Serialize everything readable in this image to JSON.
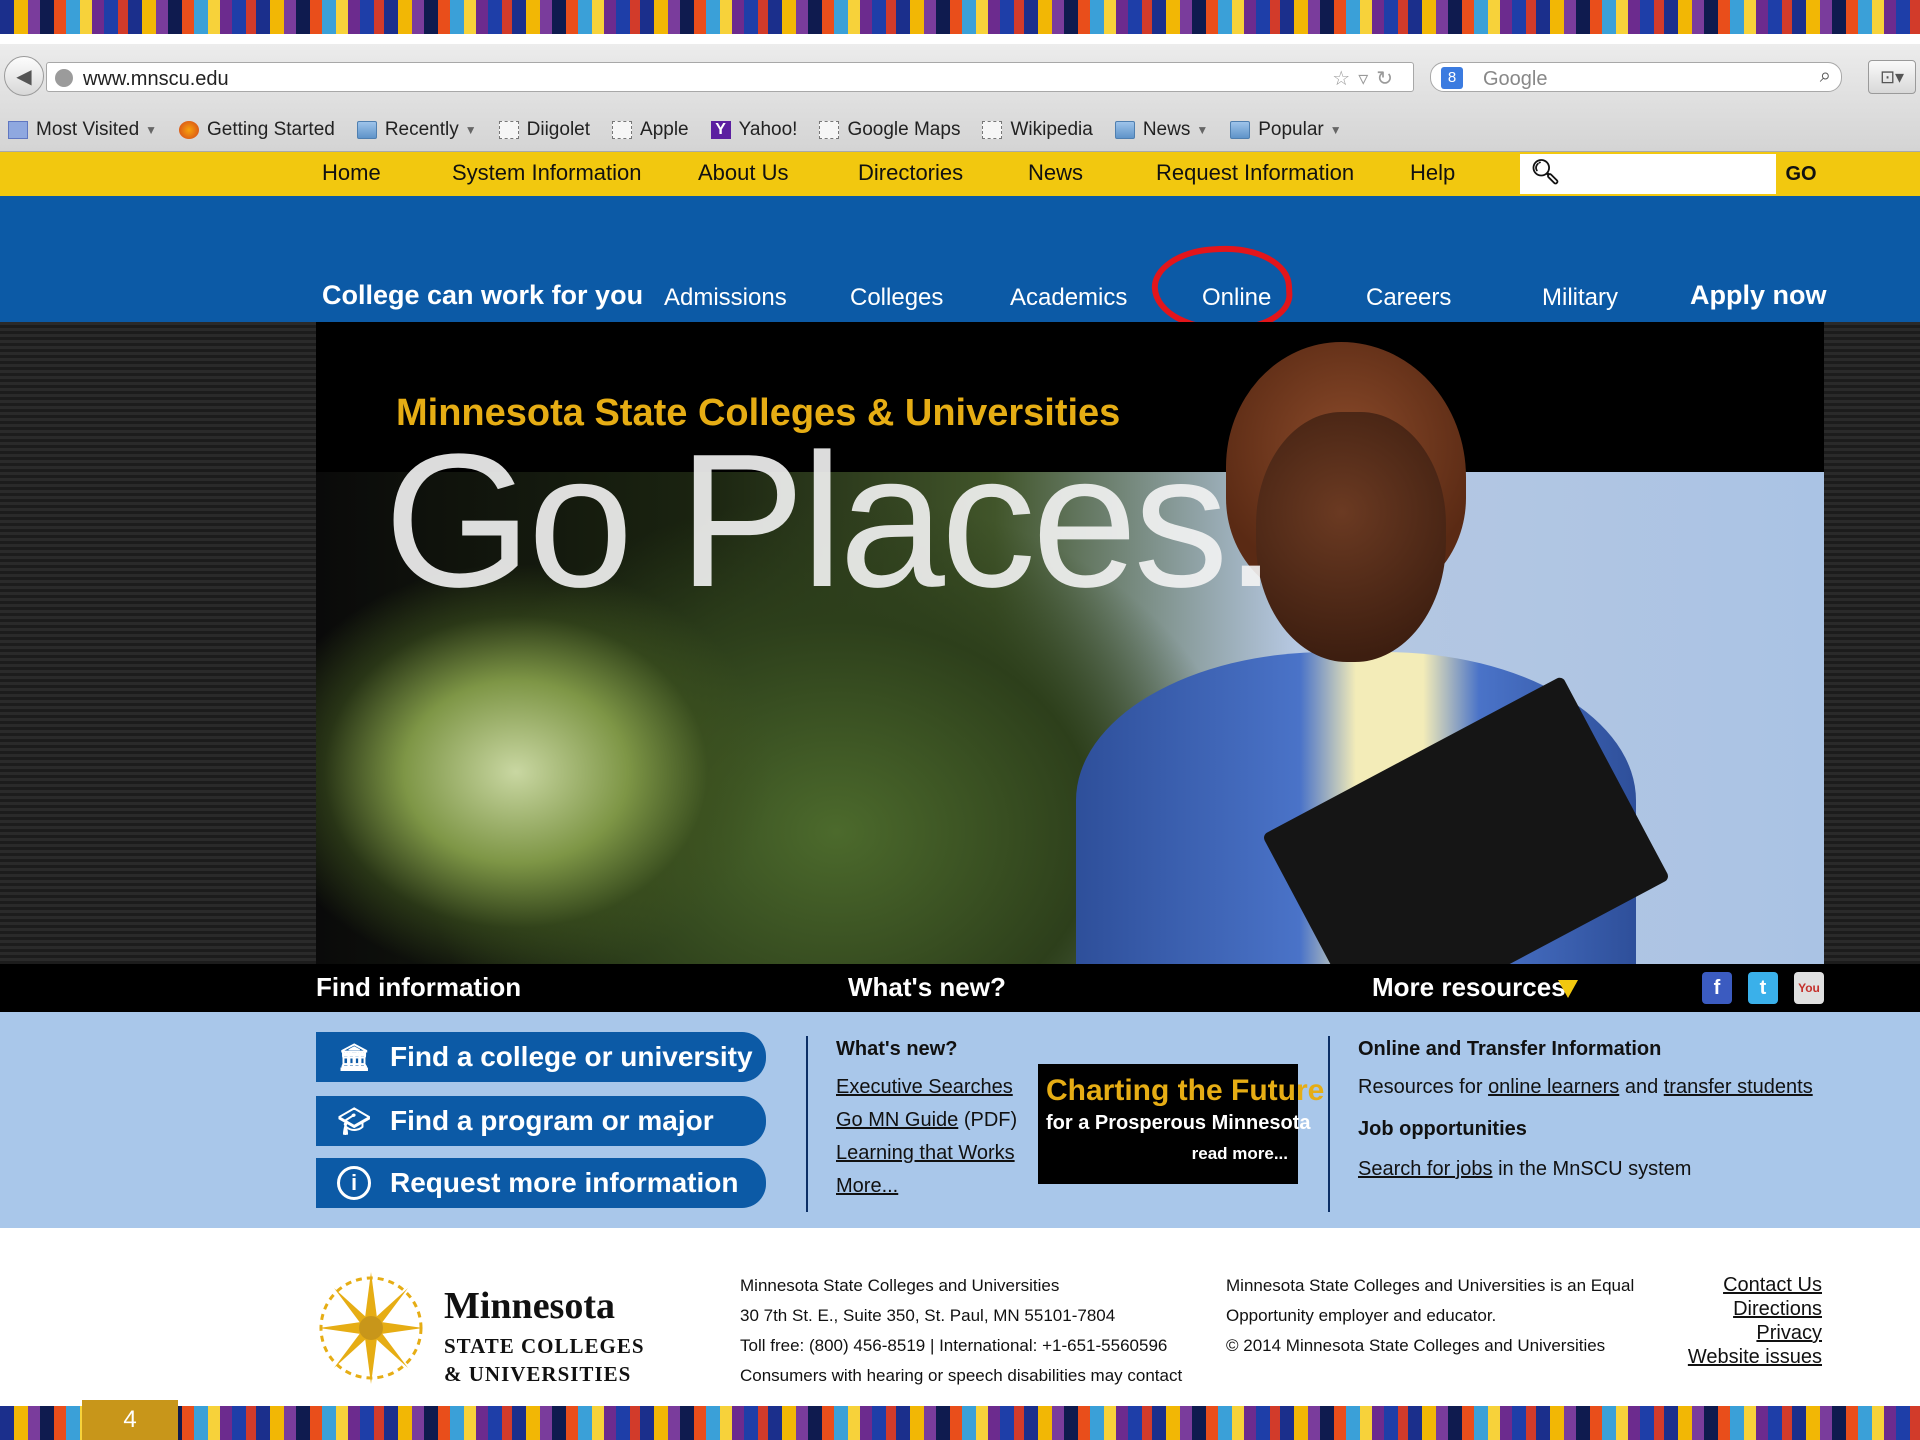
{
  "browser": {
    "url": "www.mnscu.edu",
    "search_placeholder": "Google",
    "search_badge": "8",
    "bookmarks": [
      {
        "label": "Most Visited",
        "dropdown": true,
        "icon": "most-visited-icon"
      },
      {
        "label": "Getting Started",
        "dropdown": false,
        "icon": "firefox-icon"
      },
      {
        "label": "Recently",
        "dropdown": true,
        "icon": "folder-icon"
      },
      {
        "label": "Diigolet",
        "dropdown": false,
        "icon": "page-icon"
      },
      {
        "label": "Apple",
        "dropdown": false,
        "icon": "page-icon"
      },
      {
        "label": "Yahoo!",
        "dropdown": false,
        "icon": "yahoo-icon"
      },
      {
        "label": "Google Maps",
        "dropdown": false,
        "icon": "page-icon"
      },
      {
        "label": "Wikipedia",
        "dropdown": false,
        "icon": "page-icon"
      },
      {
        "label": "News",
        "dropdown": true,
        "icon": "folder-icon"
      },
      {
        "label": "Popular",
        "dropdown": true,
        "icon": "folder-icon"
      }
    ]
  },
  "topnav": {
    "items": [
      "Home",
      "System Information",
      "About Us",
      "Directories",
      "News",
      "Request Information",
      "Help"
    ],
    "go_label": "GO"
  },
  "mainnav": {
    "tagline": "College can work for you",
    "items": [
      "Admissions",
      "Colleges",
      "Academics",
      "Online",
      "Careers",
      "Military"
    ],
    "apply": "Apply now"
  },
  "hero": {
    "subtitle": "Minnesota State Colleges & Universities",
    "title": "Go Places."
  },
  "infohead": {
    "find": "Find information",
    "whats_new": "What's new?",
    "more": "More resources",
    "social": {
      "facebook": "f",
      "twitter": "t",
      "youtube": "You Tube"
    }
  },
  "find_buttons": [
    "Find a college or university",
    "Find a program or major",
    "Request more information"
  ],
  "whats_new": {
    "heading": "What's new?",
    "links": [
      {
        "text": "Executive Searches",
        "suffix": ""
      },
      {
        "text": "Go MN Guide",
        "suffix": " (PDF)"
      },
      {
        "text": "Learning that Works",
        "suffix": ""
      },
      {
        "text": "More...",
        "suffix": ""
      }
    ],
    "promo": {
      "title": "Charting the Future",
      "subtitle": "for a Prosperous Minnesota",
      "more": "read more..."
    }
  },
  "resources": {
    "heading1": "Online and Transfer Information",
    "line1_pre": "Resources for ",
    "line1_link1": "online learners",
    "line1_mid": " and ",
    "line1_link2": "transfer students",
    "heading2": "Job opportunities",
    "line2_link": "Search for jobs",
    "line2_post": " in the MnSCU system"
  },
  "footer": {
    "logo_name": "Minnesota",
    "logo_line2": "STATE COLLEGES",
    "logo_line3": "& UNIVERSITIES",
    "address": [
      "Minnesota State Colleges and Universities",
      "30 7th St. E., Suite 350, St. Paul, MN 55101-7804",
      "Toll free: (800) 456-8519 | International: +1-651-5560596",
      "Consumers with hearing or speech disabilities may contact"
    ],
    "equal": [
      "Minnesota State Colleges and Universities is an Equal",
      "Opportunity employer and educator.",
      "© 2014 Minnesota State Colleges and Universities"
    ],
    "links": [
      "Contact Us",
      "Directions",
      "Privacy",
      "Website issues"
    ]
  },
  "slide_number": "4",
  "colors": {
    "yellow_nav": "#f2c80f",
    "blue_nav": "#0c5aa6",
    "panel": "#a9c7ea",
    "highlight_circle": "#e3151b"
  }
}
